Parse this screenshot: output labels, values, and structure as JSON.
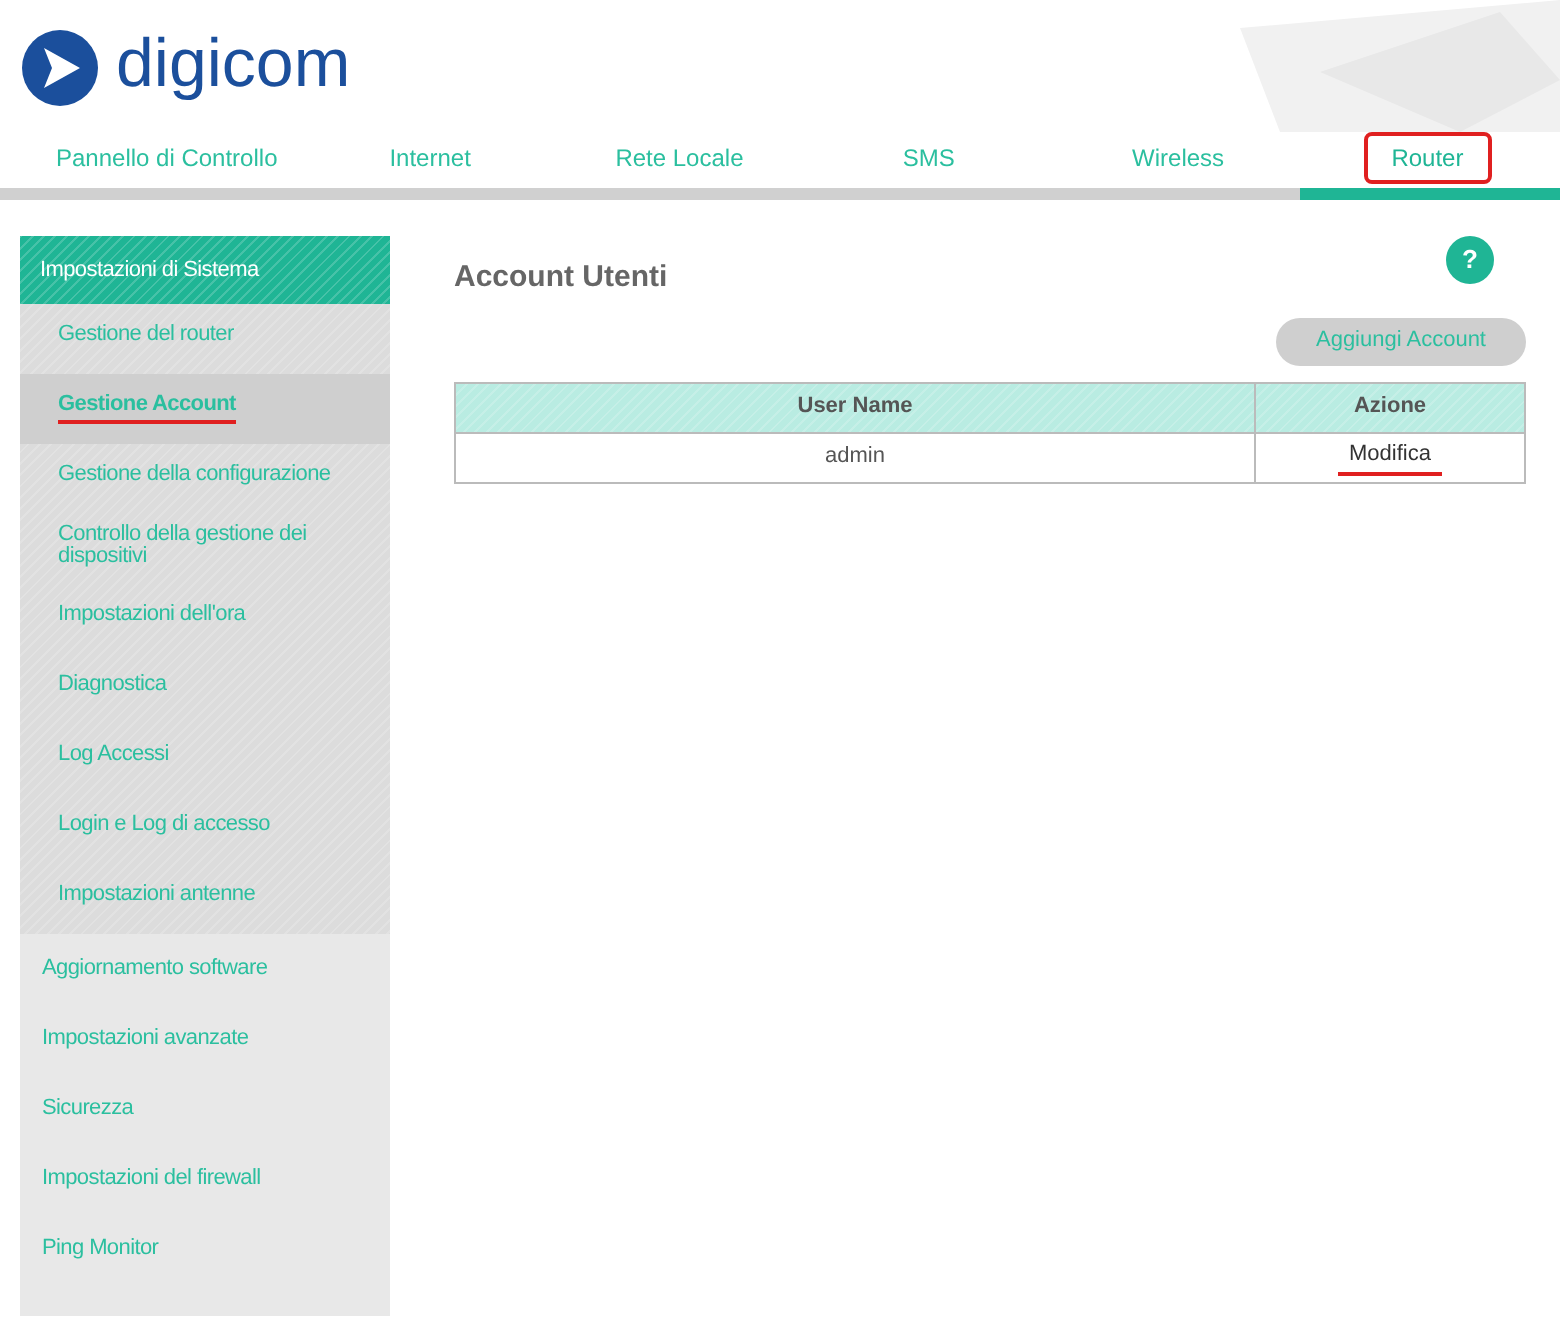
{
  "brand": {
    "name": "digicom"
  },
  "tabs": [
    {
      "label": "Pannello di Controllo",
      "selected": false,
      "marked": false
    },
    {
      "label": "Internet",
      "selected": false,
      "marked": false
    },
    {
      "label": "Rete Locale",
      "selected": false,
      "marked": false
    },
    {
      "label": "SMS",
      "selected": false,
      "marked": false
    },
    {
      "label": "Wireless",
      "selected": false,
      "marked": false
    },
    {
      "label": "Router",
      "selected": true,
      "marked": true
    }
  ],
  "sidebar": {
    "items": [
      {
        "label": "Impostazioni di Sistema",
        "expanded": true,
        "children": [
          {
            "label": "Gestione del router",
            "selected": false,
            "marked": false
          },
          {
            "label": "Gestione Account",
            "selected": true,
            "marked": true
          },
          {
            "label": "Gestione della configurazione",
            "selected": false,
            "marked": false
          },
          {
            "label": "Controllo della gestione dei dispositivi",
            "selected": false,
            "marked": false
          },
          {
            "label": "Impostazioni dell'ora",
            "selected": false,
            "marked": false
          },
          {
            "label": "Diagnostica",
            "selected": false,
            "marked": false
          },
          {
            "label": "Log Accessi",
            "selected": false,
            "marked": false
          },
          {
            "label": "Login e Log di accesso",
            "selected": false,
            "marked": false
          },
          {
            "label": "Impostazioni antenne",
            "selected": false,
            "marked": false
          }
        ]
      },
      {
        "label": "Aggiornamento software",
        "expanded": false
      },
      {
        "label": "Impostazioni avanzate",
        "expanded": false
      },
      {
        "label": "Sicurezza",
        "expanded": false
      },
      {
        "label": "Impostazioni del firewall",
        "expanded": false
      },
      {
        "label": "Ping Monitor",
        "expanded": false
      }
    ]
  },
  "content": {
    "title": "Account Utenti",
    "help": "?",
    "add_button": "Aggiungi Account",
    "table": {
      "columns": [
        "User Name",
        "Azione"
      ],
      "rows": [
        {
          "user": "admin",
          "action": "Modifica",
          "marked": true
        }
      ]
    }
  }
}
